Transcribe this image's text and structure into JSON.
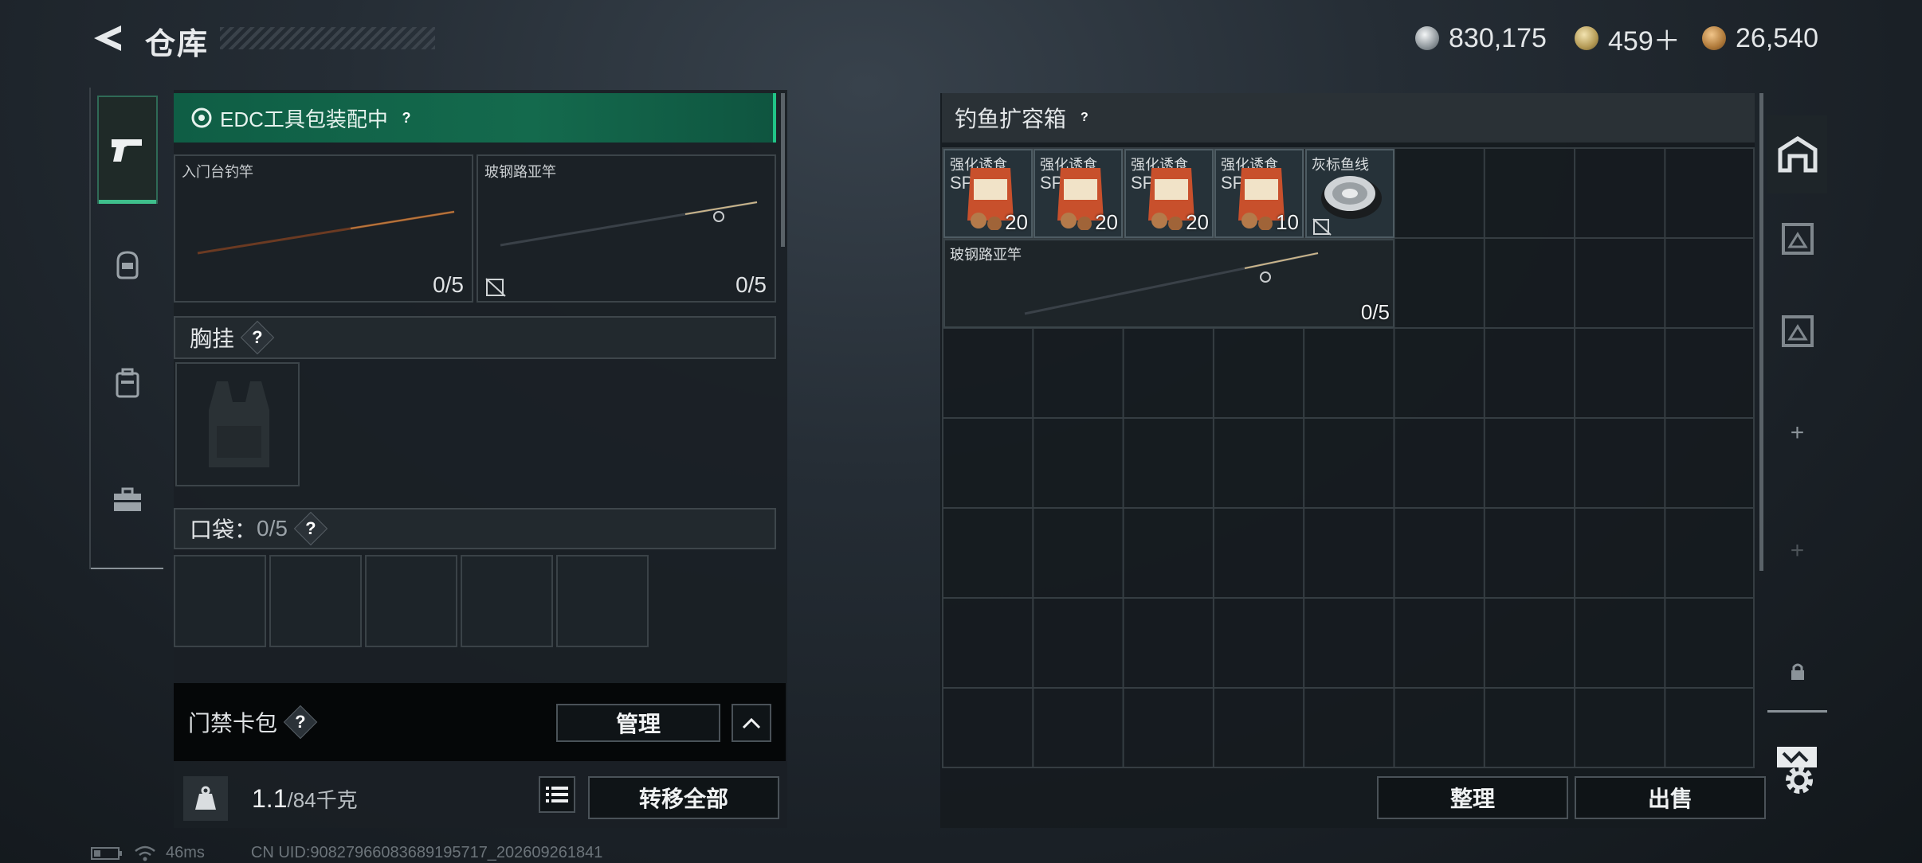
{
  "header": {
    "title": "仓库",
    "currencies": [
      {
        "icon": "silver-coin-icon",
        "value": "830,175"
      },
      {
        "icon": "gold-triangle-coin-icon",
        "value": "459＋"
      },
      {
        "icon": "bronze-coin-icon",
        "value": "26,540"
      }
    ]
  },
  "left_tabs": [
    {
      "icon": "pistol-icon",
      "active": true
    },
    {
      "icon": "helmet-icon",
      "active": false
    },
    {
      "icon": "backpack-icon",
      "active": false
    },
    {
      "icon": "toolbox-icon",
      "active": false
    }
  ],
  "loadout": {
    "edc_banner": "EDC工具包装配中",
    "rods": [
      {
        "name": "入门台钓竿",
        "count": "0/5"
      },
      {
        "name": "玻钢路亚竿",
        "count": "0/5"
      }
    ],
    "chest_label": "胸挂",
    "pocket_label": "口袋：",
    "pocket_count": "0/5",
    "keycard_label": "门禁卡包",
    "manage_btn": "管理",
    "weight_value": "1.1",
    "weight_max": "/84千克",
    "transfer_btn": "转移全部"
  },
  "storage": {
    "title": "钓鱼扩容箱",
    "items": [
      {
        "name": "强化诱食",
        "tag": "SP",
        "count": "20"
      },
      {
        "name": "强化诱食",
        "tag": "SP",
        "count": "20"
      },
      {
        "name": "强化诱食",
        "tag": "SP",
        "count": "20"
      },
      {
        "name": "强化诱食",
        "tag": "SP",
        "count": "10"
      },
      {
        "name": "灰标鱼线",
        "tag": "",
        "count": ""
      }
    ],
    "rod": {
      "name": "玻钢路亚竿",
      "count": "0/5"
    },
    "sort_btn": "整理",
    "sell_btn": "出售"
  },
  "right_tabs": [
    "home-icon",
    "box-icon",
    "box-icon",
    "plus-icon",
    "plus-icon",
    "lock-icon",
    "sort-icon",
    "gear-icon"
  ],
  "status_bar": {
    "ping": "46ms",
    "uid": "CN UID:90827966083689195717_202609261841"
  },
  "colors": {
    "accent": "#21c487",
    "banner": "#146a4d"
  }
}
